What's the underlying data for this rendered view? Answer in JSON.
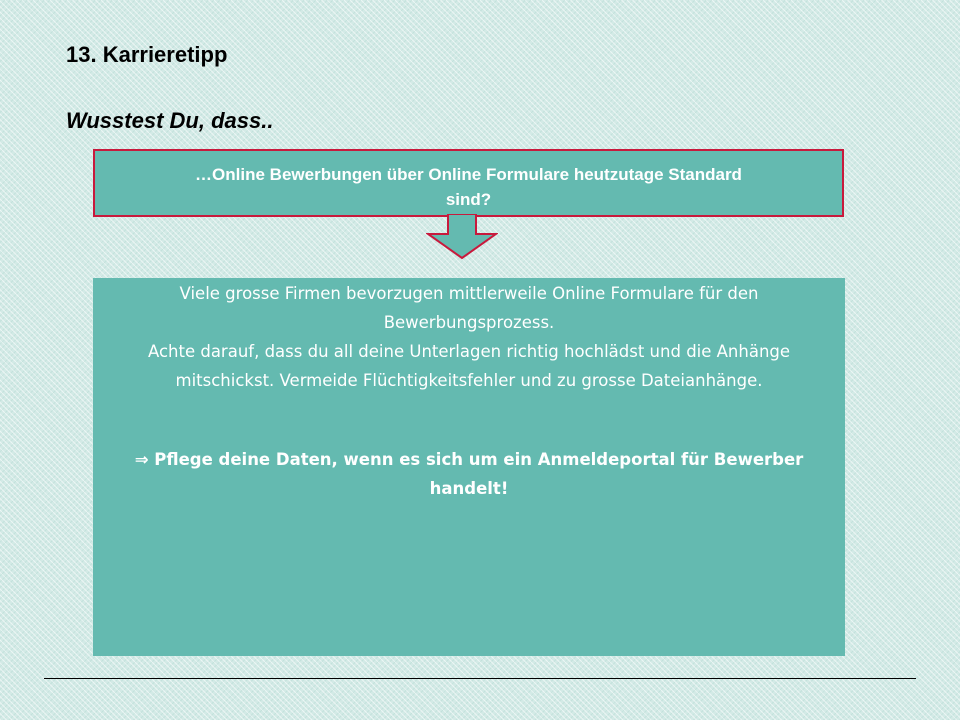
{
  "slide": {
    "title": "13. Karrieretipp",
    "subtitle": "Wusstest Du, dass.."
  },
  "question": {
    "line1": "…Online Bewerbungen über Online Formulare heutzutage Standard",
    "line2": "sind?"
  },
  "answer": {
    "line1": "Viele grosse Firmen bevorzugen mittlerweile Online Formulare für den",
    "line2": "Bewerbungsprozess.",
    "line3": "Achte darauf, dass du all deine Unterlagen richtig hochlädst und die Anhänge",
    "line4": "mitschickst. Vermeide Flüchtigkeitsfehler und zu grosse Dateianhänge.",
    "tip": "⇒ Pflege deine Daten, wenn es sich um ein Anmeldeportal für Bewerber handelt!"
  },
  "colors": {
    "box_fill": "#64bab0",
    "box_border": "#c8193c",
    "background": "#d3eae6"
  }
}
